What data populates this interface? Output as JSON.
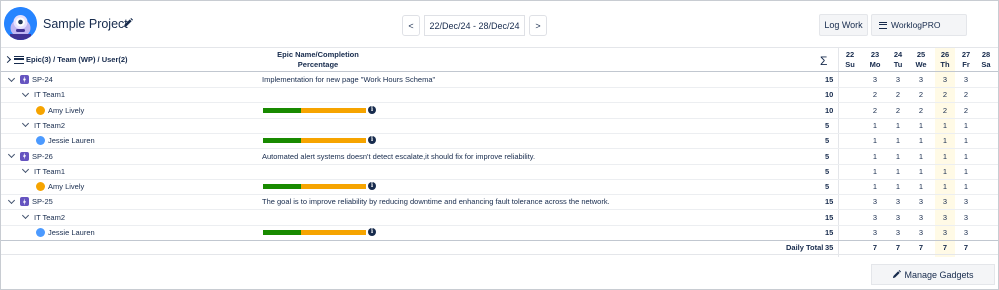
{
  "header": {
    "project_title": "Sample Project",
    "prev_label": "<",
    "next_label": ">",
    "date_range": "22/Dec/24 - 28/Dec/24",
    "log_work_label": "Log Work",
    "worklogpro_label": "WorklogPRO"
  },
  "table": {
    "col1_header": "Epic(3) / Team (WP) / User(2)",
    "col2_header_line1": "Epic Name/Completion",
    "col2_header_line2": "Percentage",
    "sigma": "Σ",
    "days": [
      {
        "num": "22",
        "wd": "Su"
      },
      {
        "num": "23",
        "wd": "Mo"
      },
      {
        "num": "24",
        "wd": "Tu"
      },
      {
        "num": "25",
        "wd": "We"
      },
      {
        "num": "26",
        "wd": "Th"
      },
      {
        "num": "27",
        "wd": "Fr"
      },
      {
        "num": "28",
        "wd": "Sa"
      }
    ],
    "highlight_day_index": 4,
    "progress_complete_fraction": 0.37,
    "colors": {
      "progress_done": "#188a00",
      "progress_remaining": "#f6a400",
      "today_highlight": "#fffae6",
      "epic_icon": "#6554c0"
    },
    "rows": [
      {
        "type": "epic",
        "label": "SP-24",
        "desc": "Implementation for new page \"Work Hours Schema\"",
        "total": "15",
        "cells": [
          "",
          "3",
          "3",
          "3",
          "3",
          "3",
          ""
        ]
      },
      {
        "type": "team",
        "label": "IT Team1",
        "total": "10",
        "cells": [
          "",
          "2",
          "2",
          "2",
          "2",
          "2",
          ""
        ]
      },
      {
        "type": "user",
        "label": "Amy Lively",
        "avatar": "amy",
        "total": "10",
        "cells": [
          "",
          "2",
          "2",
          "2",
          "2",
          "2",
          ""
        ]
      },
      {
        "type": "team",
        "label": "IT Team2",
        "total": "5",
        "cells": [
          "",
          "1",
          "1",
          "1",
          "1",
          "1",
          ""
        ]
      },
      {
        "type": "user",
        "label": "Jessie Lauren",
        "avatar": "jessie",
        "total": "5",
        "cells": [
          "",
          "1",
          "1",
          "1",
          "1",
          "1",
          ""
        ]
      },
      {
        "type": "epic",
        "label": "SP-26",
        "desc": "Automated alert systems doesn't detect escalate,it should fix for improve reliability.",
        "total": "5",
        "cells": [
          "",
          "1",
          "1",
          "1",
          "1",
          "1",
          ""
        ]
      },
      {
        "type": "team",
        "label": "IT Team1",
        "total": "5",
        "cells": [
          "",
          "1",
          "1",
          "1",
          "1",
          "1",
          ""
        ]
      },
      {
        "type": "user",
        "label": "Amy Lively",
        "avatar": "amy",
        "total": "5",
        "cells": [
          "",
          "1",
          "1",
          "1",
          "1",
          "1",
          ""
        ]
      },
      {
        "type": "epic",
        "label": "SP-25",
        "desc": "The goal is to improve reliability by reducing downtime and enhancing fault tolerance across the network.",
        "total": "15",
        "cells": [
          "",
          "3",
          "3",
          "3",
          "3",
          "3",
          ""
        ]
      },
      {
        "type": "team",
        "label": "IT Team2",
        "total": "15",
        "cells": [
          "",
          "3",
          "3",
          "3",
          "3",
          "3",
          ""
        ]
      },
      {
        "type": "user",
        "label": "Jessie Lauren",
        "avatar": "jessie",
        "total": "15",
        "cells": [
          "",
          "3",
          "3",
          "3",
          "3",
          "3",
          ""
        ]
      }
    ],
    "footer": {
      "label": "Daily Total",
      "total": "35",
      "cells": [
        "",
        "7",
        "7",
        "7",
        "7",
        "7",
        ""
      ]
    }
  },
  "footer_bar": {
    "manage_gadgets_label": "Manage Gadgets"
  }
}
